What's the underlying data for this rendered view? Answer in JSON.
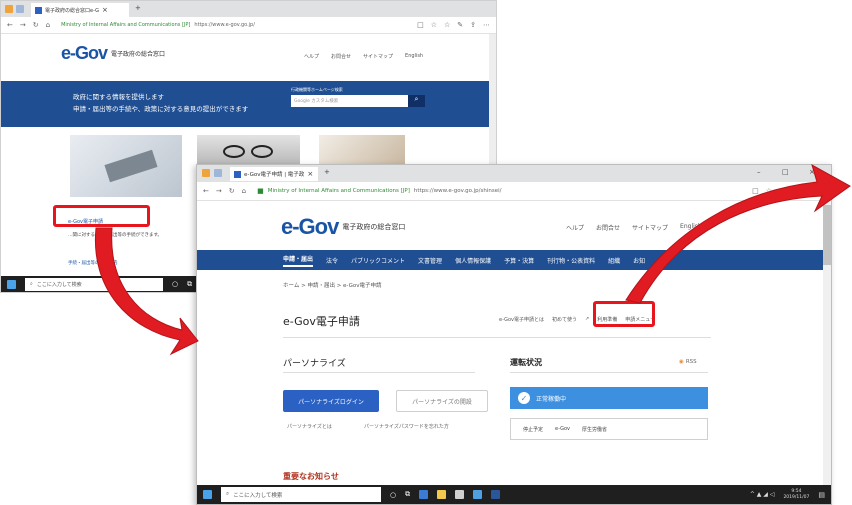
{
  "win1": {
    "tab_title": "電子政府の総合窓口e-G",
    "tab_close": "×",
    "tab_new": "+",
    "url_site": "Ministry of Internal Affairs and Communications [JP]",
    "url": "https://www.e-gov.go.jp/",
    "logo_e": "e-Gov",
    "logo_kana": "(イーガブ)",
    "logo_tagline": "電子政府の総合窓口",
    "header_links": [
      "ヘルプ",
      "お問合せ",
      "サイトマップ",
      "English"
    ],
    "banner_line1": "政府に関する情報を提供します",
    "banner_line2": "申請・届出等の手続や、政策に対する意見の提出ができます",
    "search_label": "行政機関等ホームページ検索",
    "search_placeholder": "Google カスタム検索",
    "service_link": "e-Gov電子申請",
    "service_desc": "…関に対する申請・届出等の手続ができます。",
    "bottom_link": "手続・届出等の手続案内",
    "taskbar_search": "ここに入力して検索"
  },
  "win2": {
    "tab_title": "e-Gov電子申請 | 電子政",
    "tab_close": "×",
    "tab_new": "+",
    "url_site": "Ministry of Internal Affairs and Communications [JP]",
    "url": "https://www.e-gov.go.jp/shinsei/",
    "logo_e": "e-Gov",
    "logo_kana": "(イーガブ)",
    "logo_tagline": "電子政府の総合窓口",
    "header_links": [
      "ヘルプ",
      "お問合せ",
      "サイトマップ",
      "English"
    ],
    "nav_items": [
      "申請・届出",
      "法令",
      "パブリックコメント",
      "文書管理",
      "個人情報保護",
      "予算・決算",
      "刊行物・公表資料",
      "組織",
      "お知"
    ],
    "breadcrumb": "ホーム > 申請・届出 > e-Gov電子申請",
    "page_title": "e-Gov電子申請",
    "sub_links": {
      "about": "e-Gov電子申請とは",
      "first_time": "初めて使う",
      "preparation": "利用準備",
      "menu": "申請メニュー"
    },
    "personalize": {
      "heading": "パーソナライズ",
      "login_button": "パーソナライズログイン",
      "register_button": "パーソナライズの開設",
      "what_link": "パーソナライズとは",
      "forgot_link": "パーソナライズパスワードを忘れた方"
    },
    "status": {
      "heading": "運転状況",
      "rss": "RSS",
      "running": "正常稼働中",
      "stop_label": "停止予定",
      "stop_e": "e-Gov",
      "stop_ministry": "厚生労働省"
    },
    "notice_heading": "重要なお知らせ",
    "taskbar_search": "ここに入力して検索",
    "time": "9:54",
    "date": "2019/11/07"
  }
}
